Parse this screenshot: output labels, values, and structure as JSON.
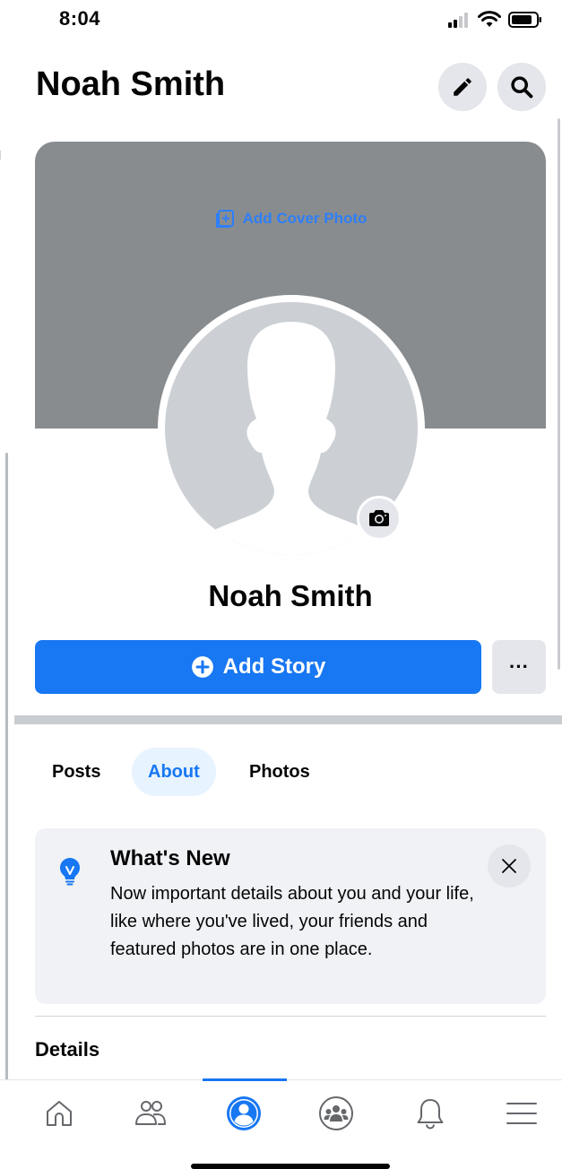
{
  "status_bar": {
    "time": "8:04"
  },
  "header": {
    "title": "Noah Smith"
  },
  "cover": {
    "add_label": "Add Cover Photo"
  },
  "profile": {
    "name": "Noah Smith"
  },
  "actions": {
    "add_story_label": "Add Story",
    "more_label": "···"
  },
  "tabs": [
    {
      "label": "Posts",
      "active": false
    },
    {
      "label": "About",
      "active": true
    },
    {
      "label": "Photos",
      "active": false
    }
  ],
  "whats_new": {
    "title": "What's New",
    "body": "Now important details about you and your life, like where you've lived, your friends and featured photos are in one place."
  },
  "details": {
    "title": "Details"
  },
  "icons": {
    "edit": "pencil-icon",
    "search": "search-icon",
    "camera": "camera-icon",
    "add_story": "plus-circle-icon",
    "whats_new": "lightbulb-icon",
    "close": "close-icon",
    "nav": [
      "home-icon",
      "friends-icon",
      "profile-icon",
      "groups-icon",
      "bell-icon",
      "menu-icon"
    ]
  },
  "colors": {
    "accent": "#1877f2",
    "cover": "#898c8f",
    "avatar_bg": "#ccd0d5",
    "button_grey": "#e4e6eb",
    "card_bg": "#f0f2f5"
  }
}
